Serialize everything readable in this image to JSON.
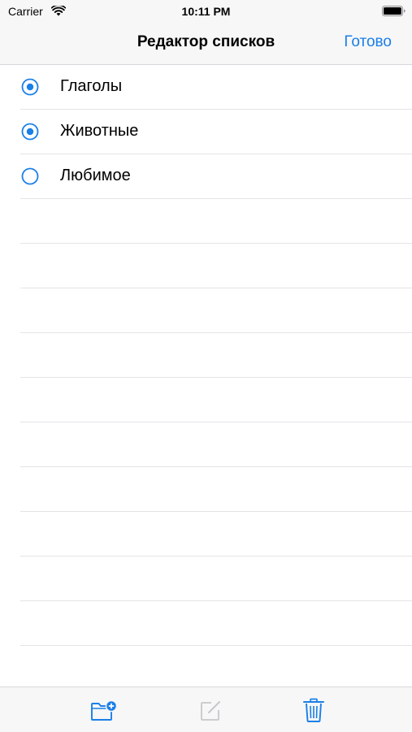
{
  "status_bar": {
    "carrier": "Carrier",
    "time": "10:11 PM",
    "wifi_icon": "wifi-icon",
    "battery_icon": "battery-icon"
  },
  "nav": {
    "title": "Редактор списков",
    "done_label": "Готово"
  },
  "lists": [
    {
      "label": "Глаголы",
      "selected": true
    },
    {
      "label": "Животные",
      "selected": true
    },
    {
      "label": "Любимое",
      "selected": false
    }
  ],
  "toolbar": {
    "new_folder_icon": "folder-add-icon",
    "edit_icon": "compose-icon",
    "edit_enabled": false,
    "trash_icon": "trash-icon"
  },
  "colors": {
    "accent": "#1a7fe8",
    "disabled": "#c7c7cc",
    "separator": "#e4e4e7",
    "bar_background": "#f7f7f7"
  }
}
